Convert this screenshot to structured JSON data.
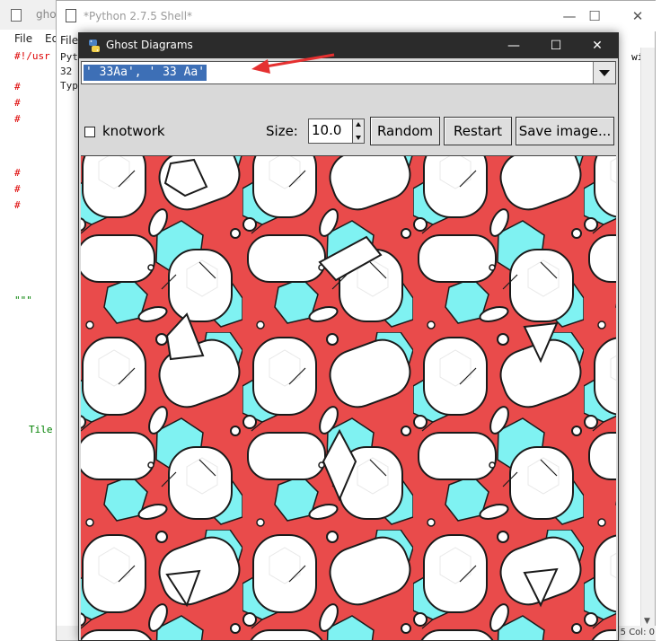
{
  "editor": {
    "title": "ghos",
    "menu": [
      "File",
      "Ed"
    ],
    "lines": [
      {
        "text": "#!/usr",
        "style": "red"
      },
      {
        "text": "#",
        "style": "red"
      },
      {
        "text": "#",
        "style": "red"
      },
      {
        "text": "#",
        "style": "red"
      },
      {
        "text": "#",
        "style": "red"
      },
      {
        "text": "#",
        "style": "red"
      },
      {
        "text": "#",
        "style": "red"
      },
      {
        "text": "\"\"\"",
        "style": "green"
      },
      {
        "text": "Tile",
        "style": "green"
      }
    ]
  },
  "shell": {
    "title": "*Python 2.7.5 Shell*",
    "menu": [
      "File"
    ],
    "lines": [
      "Pyt",
      "32",
      "Typ"
    ],
    "right_fragment": "win",
    "status": "5 Col: 0"
  },
  "ghost": {
    "title": "Ghost Diagrams",
    "window_controls": {
      "minimize": "—",
      "maximize": "☐",
      "close": "✕"
    },
    "tile_spec": "' 33Aa', ' 33 Aa'",
    "knotwork_label": "knotwork",
    "knotwork_checked": false,
    "size_label": "Size:",
    "size_value": "10.0",
    "buttons": {
      "random": "Random",
      "restart": "Restart",
      "save": "Save image..."
    },
    "colors": {
      "red": "#e94b4b",
      "cyan": "#7ff2f2",
      "white": "#ffffff",
      "outline": "#1a1a1a"
    }
  },
  "annotation": {
    "color": "#e53030",
    "icon": "red-arrow-icon"
  }
}
